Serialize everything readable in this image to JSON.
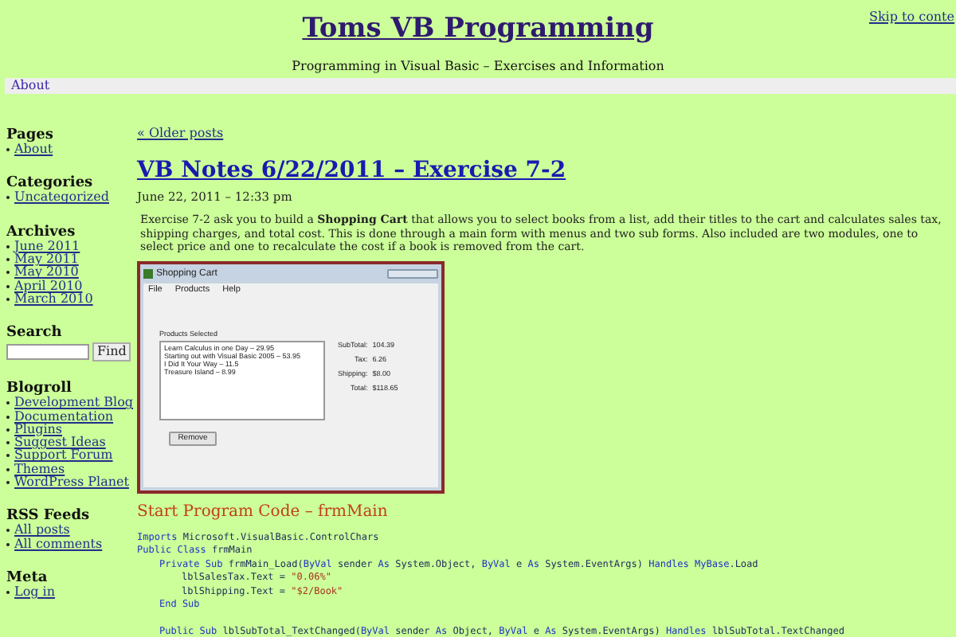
{
  "header": {
    "skip_link": "Skip to conte",
    "title": "Toms VB Programming",
    "tagline": "Programming in Visual Basic – Exercises and Information"
  },
  "nav": [
    {
      "label": "About"
    }
  ],
  "sidebar": [
    {
      "kind": "links",
      "heading": "Pages",
      "items": [
        "About"
      ]
    },
    {
      "kind": "links",
      "heading": "Categories",
      "items": [
        "Uncategorized"
      ]
    },
    {
      "kind": "links",
      "heading": "Archives",
      "items": [
        "June 2011",
        "May 2011",
        "May 2010",
        "April 2010",
        "March 2010"
      ]
    },
    {
      "kind": "search",
      "heading": "Search",
      "button": "Find"
    },
    {
      "kind": "links",
      "heading": "Blogroll",
      "items": [
        "Development Blog",
        "Documentation",
        "Plugins",
        "Suggest Ideas",
        "Support Forum",
        "Themes",
        "WordPress Planet"
      ]
    },
    {
      "kind": "links",
      "heading": "RSS Feeds",
      "items": [
        "All posts",
        "All comments"
      ]
    },
    {
      "kind": "links",
      "heading": "Meta",
      "items": [
        "Log in"
      ]
    }
  ],
  "main": {
    "older_link": "« Older posts",
    "post": {
      "title": "VB Notes 6/22/2011 – Exercise 7-2",
      "date": "June 22, 2011 – 12:33 pm",
      "body": "Exercise 7-2 ask you to build a **Shopping Cart** that allows you to select books from a list, add their titles to the cart and calculates sales tax, shipping charges, and total cost. This is done through a main form with menus and two sub forms. Also included are two modules, one to select price and one to recalculate the cost if a book is removed from the cart.",
      "app_window": {
        "title": "Shopping Cart",
        "menu": [
          "File",
          "Products",
          "Help"
        ],
        "list_label": "Products Selected",
        "list_items": [
          "Learn Calculus in one Day – 29.95",
          "Starting out with Visual Basic 2005 – 53.95",
          "I Did It Your Way – 11.5",
          "Treasure Island – 8.99"
        ],
        "totals": [
          {
            "label": "SubTotal:",
            "value": "104.39"
          },
          {
            "label": "Tax:",
            "value": "6.26"
          },
          {
            "label": "Shipping:",
            "value": "$8.00"
          },
          {
            "label": "Total:",
            "value": "$118.65"
          }
        ],
        "button": "Remove"
      },
      "code_heading": "Start Program Code –  frmMain",
      "code": [
        {
          "tokens": [
            {
              "text": "Imports",
              "kind": "keyword"
            },
            {
              "text": " Microsoft.VisualBasic.ControlChars",
              "kind": "plain"
            }
          ]
        },
        {
          "tokens": [
            {
              "text": "Public Class",
              "kind": "keyword"
            },
            {
              "text": " frmMain",
              "kind": "plain"
            }
          ],
          "children": [
            {
              "tokens": [
                {
                  "text": "Private Sub",
                  "kind": "keyword"
                },
                {
                  "text": " frmMain_Load(",
                  "kind": "plain"
                },
                {
                  "text": "ByVal",
                  "kind": "keyword"
                },
                {
                  "text": " sender ",
                  "kind": "plain"
                },
                {
                  "text": "As",
                  "kind": "keyword"
                },
                {
                  "text": " System.Object, ",
                  "kind": "plain"
                },
                {
                  "text": "ByVal",
                  "kind": "keyword"
                },
                {
                  "text": " e ",
                  "kind": "plain"
                },
                {
                  "text": "As",
                  "kind": "keyword"
                },
                {
                  "text": " System.EventArgs) ",
                  "kind": "plain"
                },
                {
                  "text": "Handles",
                  "kind": "keyword"
                },
                {
                  "text": " MyBase",
                  "kind": "keyword"
                },
                {
                  "text": ".Load",
                  "kind": "plain"
                }
              ],
              "children": [
                {
                  "tokens": [
                    {
                      "text": "lblSalesTax.Text = ",
                      "kind": "plain"
                    },
                    {
                      "text": "\"0.06%\"",
                      "kind": "string"
                    }
                  ]
                },
                {
                  "tokens": [
                    {
                      "text": "lblShipping.Text = ",
                      "kind": "plain"
                    },
                    {
                      "text": "\"$2/Book\"",
                      "kind": "string"
                    }
                  ]
                }
              ]
            },
            {
              "tokens": [
                {
                  "text": "End Sub",
                  "kind": "keyword"
                }
              ]
            },
            {
              "blank_before": true,
              "tokens": [
                {
                  "text": "Public Sub",
                  "kind": "keyword"
                },
                {
                  "text": " lblSubTotal_TextChanged(",
                  "kind": "plain"
                },
                {
                  "text": "ByVal",
                  "kind": "keyword"
                },
                {
                  "text": " sender ",
                  "kind": "plain"
                },
                {
                  "text": "As",
                  "kind": "keyword"
                },
                {
                  "text": " Object, ",
                  "kind": "plain"
                },
                {
                  "text": "ByVal",
                  "kind": "keyword"
                },
                {
                  "text": " e ",
                  "kind": "plain"
                },
                {
                  "text": "As",
                  "kind": "keyword"
                },
                {
                  "text": " System.EventArgs) ",
                  "kind": "plain"
                },
                {
                  "text": "Handles",
                  "kind": "keyword"
                },
                {
                  "text": " lblSubTotal.TextChanged",
                  "kind": "plain"
                }
              ]
            }
          ]
        }
      ]
    }
  }
}
